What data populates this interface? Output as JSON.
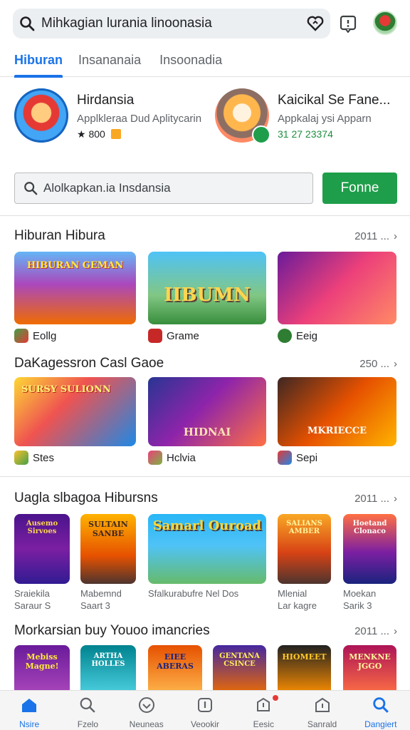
{
  "topbar": {
    "search_text": "Mihkagian lurania linoonasia",
    "icons": [
      "search-icon",
      "heart-icon",
      "notification-icon",
      "avatar"
    ]
  },
  "tabs": [
    {
      "label": "Hiburan",
      "active": true
    },
    {
      "label": "Insananaia",
      "active": false
    },
    {
      "label": "Insoonadia",
      "active": false
    }
  ],
  "featured": [
    {
      "title": "Hirdansia",
      "subtitle": "Applkleraa Dud Aplitycarin",
      "rating": "★ 800",
      "meta_color": "#202124"
    },
    {
      "title": "Kaicikal Se Fane...",
      "subtitle": "Appkalaj ysi Apparn",
      "rating": "31 27 23374",
      "meta_color": "#1e8e3e"
    }
  ],
  "search2": {
    "placeholder": "Alolkapkan.ia Insdansia",
    "button": "Fonne"
  },
  "sections": [
    {
      "title": "Hiburan Hibura",
      "more": "2011 ...",
      "cards": [
        {
          "art": "HIBURAN GEMAN",
          "caption": "Eollg"
        },
        {
          "art": "IIBUMN",
          "caption": "Grame"
        },
        {
          "art": "",
          "caption": "Eeig"
        }
      ]
    },
    {
      "title": "DaKagessron Casl Gaoe",
      "more": "250 ...",
      "cards": [
        {
          "art": "SURSY SULIONN",
          "caption": "Stes"
        },
        {
          "art": "HIDNAI",
          "caption": "Hclvia"
        },
        {
          "art": "MKRIECCE",
          "caption": "Sepi"
        }
      ]
    },
    {
      "title": "Uagla slbagoa Hibursns",
      "more": "2011 ...",
      "cards": [
        {
          "art": "Ausemo Sirvoes",
          "caption": "Sraiekila",
          "caption2": "Saraur S"
        },
        {
          "art": "SULTAIN SANBE",
          "caption": "Mabemnd",
          "caption2": "Saart 3"
        },
        {
          "art": "Samarl Ouroad",
          "caption": "Sfalkurabufre Nel Dos",
          "caption2": ""
        },
        {
          "art": "SALIANS AMBER",
          "caption": "Mlenial",
          "caption2": "Lar kagre"
        },
        {
          "art": "Hoetand Clonaco",
          "caption": "Moekan",
          "caption2": "Sarik 3"
        }
      ]
    },
    {
      "title": "Morkarsian buy Youoo imancries",
      "more": "2011 ...",
      "cards": [
        {
          "art": "Mebiss Magne!"
        },
        {
          "art": "ARTHA HOLLES"
        },
        {
          "art": "EIEE ABERAS"
        },
        {
          "art": "GENTANA CSINCE"
        },
        {
          "art": "HIOMEET"
        },
        {
          "art": "MENKNE JGGO"
        }
      ]
    }
  ],
  "bottomnav": [
    {
      "label": "Nsire",
      "icon": "home-icon",
      "active": true
    },
    {
      "label": "Fzelo",
      "icon": "search-icon",
      "active": false
    },
    {
      "label": "Neuneas",
      "icon": "heart-icon",
      "active": false
    },
    {
      "label": "Veookir",
      "icon": "info-icon",
      "active": false
    },
    {
      "label": "Eesic",
      "icon": "tag-icon",
      "active": false,
      "badge": true
    },
    {
      "label": "Sanrald",
      "icon": "store-icon",
      "active": false
    },
    {
      "label": "Dangiert",
      "icon": "search-icon",
      "active": true
    }
  ]
}
